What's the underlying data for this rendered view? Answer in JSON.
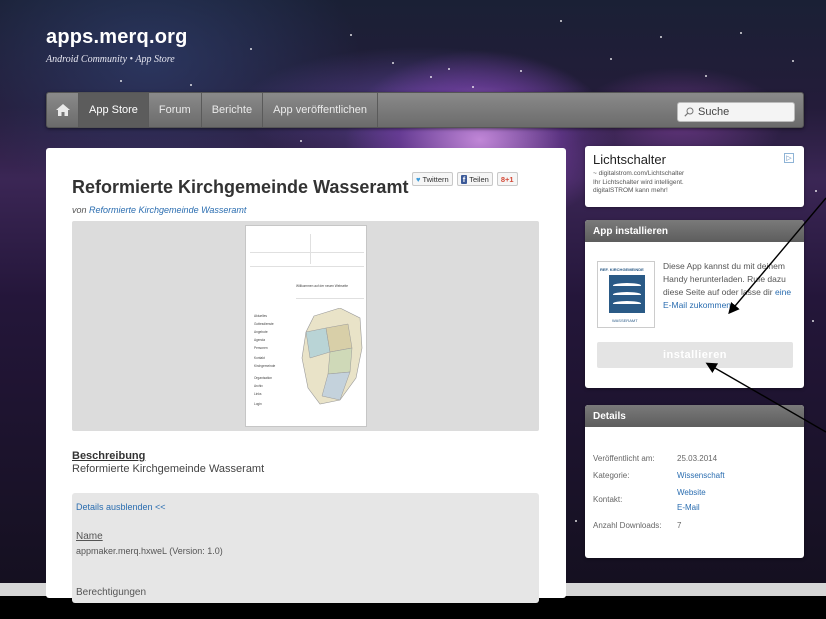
{
  "site": {
    "title": "apps.merq.org",
    "subtitle": "Android Community • App Store"
  },
  "nav": {
    "items": [
      {
        "label": "App Store",
        "active": true
      },
      {
        "label": "Forum"
      },
      {
        "label": "Berichte"
      },
      {
        "label": "App veröffentlichen"
      }
    ],
    "search_placeholder": "Suche"
  },
  "app": {
    "title": "Reformierte Kirchgemeinde Wasseramt",
    "by_prefix": "von",
    "author": "Reformierte Kirchgemeinde Wasseramt"
  },
  "share": {
    "twitter": "Twittern",
    "facebook": "Teilen",
    "gplus": "+1"
  },
  "thumbnail": {
    "heading": "Willkommen auf der neuen Webseite",
    "menu": [
      "Aktuelles",
      "Gottesdienste",
      "Angebote",
      "Agenda",
      "Personen",
      "Kontakt",
      "Kirchgemeinde",
      "Organisation",
      "Archiv",
      "Links",
      "Login"
    ]
  },
  "description": {
    "heading": "Beschreibung",
    "text": "Reformierte Kirchgemeinde Wasseramt"
  },
  "details_section": {
    "toggle": "Details ausblenden <<",
    "name_heading": "Name",
    "name_value": "appmaker.merq.hxweL (Version: 1.0)",
    "permissions_heading": "Berechtigungen"
  },
  "ad": {
    "title": "Lichtschalter",
    "url": "digitalstrom.com/Lichtschalter",
    "line1": "Ihr Lichtschalter wird intelligent.",
    "line2": "digitalSTROM kann mehr!"
  },
  "install": {
    "header": "App installieren",
    "logo_top": "REF. KIRCHGEMEINDE",
    "logo_bottom": "WASSERAMT",
    "text": "Diese App kannst du mit deinem Handy herunterladen. Rufe dazu diese Seite auf oder lasse dir",
    "link": "eine E-Mail",
    "text_after": "zukommen.",
    "button": "installieren"
  },
  "details": {
    "header": "Details",
    "published_label": "Veröffentlicht am:",
    "published_value": "25.03.2014",
    "category_label": "Kategorie:",
    "category_value": "Wissenschaft",
    "contact_label": "Kontakt:",
    "contact_website": "Website",
    "contact_email": "E-Mail",
    "downloads_label": "Anzahl Downloads:",
    "downloads_value": "7"
  }
}
